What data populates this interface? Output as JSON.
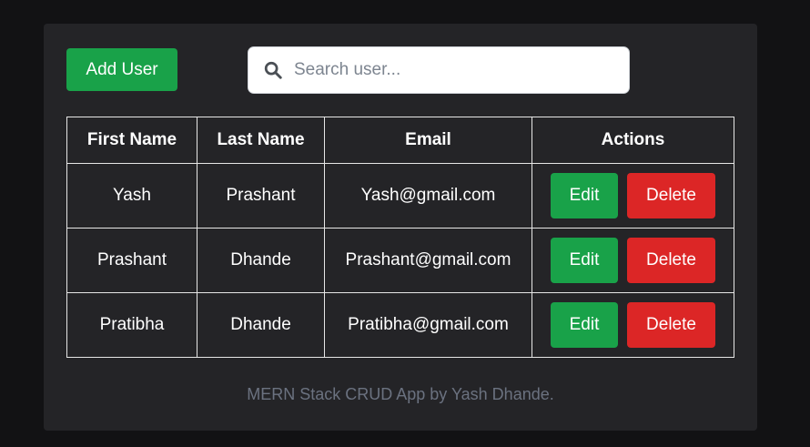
{
  "toolbar": {
    "add_label": "Add User"
  },
  "search": {
    "placeholder": "Search user..."
  },
  "table": {
    "headers": [
      "First Name",
      "Last Name",
      "Email",
      "Actions"
    ],
    "rows": [
      {
        "first": "Yash",
        "last": "Prashant",
        "email": "Yash@gmail.com"
      },
      {
        "first": "Prashant",
        "last": "Dhande",
        "email": "Prashant@gmail.com"
      },
      {
        "first": "Pratibha",
        "last": "Dhande",
        "email": "Pratibha@gmail.com"
      }
    ],
    "edit_label": "Edit",
    "delete_label": "Delete"
  },
  "footer": {
    "text": "MERN Stack CRUD App by Yash Dhande."
  },
  "colors": {
    "success": "#19a249",
    "danger": "#dc2626",
    "card": "#242427",
    "background": "#121214"
  }
}
